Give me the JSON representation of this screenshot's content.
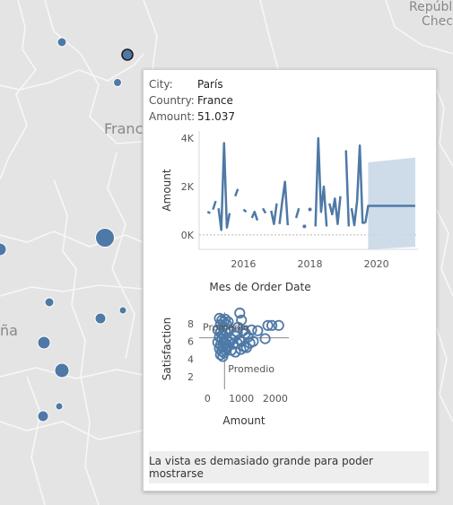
{
  "map": {
    "labels": {
      "france": "Franc",
      "spain": "ña",
      "czech_1": "Repúbl",
      "czech_2": "Checa"
    }
  },
  "tooltip": {
    "fields": [
      {
        "key": "City:",
        "value": "París"
      },
      {
        "key": "Country:",
        "value": "France"
      },
      {
        "key": "Amount:",
        "value": "51.037"
      }
    ],
    "footer": "La vista es demasiado grande para poder mostrarse"
  },
  "chart_data": [
    {
      "type": "line",
      "xlabel": "Mes de Order Date",
      "ylabel": "Amount",
      "x_ticks": [
        "2016",
        "2018",
        "2020"
      ],
      "y_ticks": [
        "4K",
        "2K",
        "0K"
      ],
      "xlim": [
        "2014-09",
        "2021-04"
      ],
      "ylim": [
        -600,
        4300
      ],
      "series_color": "#4e79a7",
      "forecast_color": "#c9d8e8",
      "segments": [
        [
          [
            "2014-12",
            950
          ],
          [
            "2015-01",
            900
          ]
        ],
        [
          [
            "2015-02",
            1050
          ],
          [
            "2015-03",
            1400
          ]
        ],
        [
          [
            "2015-04",
            1100
          ],
          [
            "2015-05",
            200
          ],
          [
            "2015-06",
            3800
          ],
          [
            "2015-07",
            300
          ],
          [
            "2015-08",
            900
          ]
        ],
        [
          [
            "2015-10",
            1600
          ],
          [
            "2015-11",
            1900
          ]
        ],
        [
          [
            "2016-01",
            1050
          ],
          [
            "2016-02",
            950
          ]
        ],
        [
          [
            "2016-04",
            700
          ],
          [
            "2016-05",
            950
          ],
          [
            "2016-06",
            600
          ]
        ],
        [
          [
            "2016-08",
            1100
          ],
          [
            "2016-09",
            900
          ]
        ],
        [
          [
            "2016-11",
            1000
          ],
          [
            "2016-12",
            450
          ],
          [
            "2017-01",
            1300
          ]
        ],
        [
          [
            "2017-02",
            450
          ],
          [
            "2017-03",
            1400
          ],
          [
            "2017-04",
            2200
          ],
          [
            "2017-05",
            400
          ]
        ],
        [
          [
            "2017-08",
            700
          ],
          [
            "2017-09",
            1100
          ]
        ],
        [
          [
            "2017-11",
            350
          ]
        ],
        [
          [
            "2018-01",
            1050
          ]
        ],
        [
          [
            "2018-03",
            350
          ],
          [
            "2018-04",
            4000
          ],
          [
            "2018-05",
            950
          ],
          [
            "2018-06",
            2000
          ],
          [
            "2018-07",
            350
          ]
        ],
        [
          [
            "2018-08",
            1300
          ],
          [
            "2018-09",
            850
          ],
          [
            "2018-10",
            1500
          ],
          [
            "2018-11",
            450
          ],
          [
            "2018-12",
            1600
          ]
        ],
        [
          [
            "2019-02",
            3500
          ],
          [
            "2019-03",
            350
          ]
        ],
        [
          [
            "2019-04",
            1100
          ],
          [
            "2019-05",
            400
          ],
          [
            "2019-06",
            1400
          ],
          [
            "2019-07",
            3700
          ],
          [
            "2019-08",
            500
          ],
          [
            "2019-09",
            500
          ]
        ],
        [
          [
            "2019-09",
            500
          ],
          [
            "2019-10",
            1200
          ],
          [
            "2021-03",
            1200
          ]
        ]
      ],
      "forecast_band": {
        "from": "2019-10",
        "to": "2021-03",
        "upper_start": 3000,
        "upper_end": 3200,
        "lower_start": -600,
        "lower_end": -500
      }
    },
    {
      "type": "scatter",
      "xlabel": "Amount",
      "ylabel": "Satisfaction",
      "x_ticks": [
        0,
        1000,
        2000
      ],
      "y_ticks": [
        2,
        4,
        6,
        8
      ],
      "xlim": [
        -250,
        2400
      ],
      "ylim": [
        1,
        9.3
      ],
      "reference_lines": {
        "x": 500,
        "y": 6.4
      },
      "reference_labels": [
        "Promedio",
        "Promedio"
      ],
      "series_color": "#4e79a7",
      "points": [
        [
          350,
          8.6
        ],
        [
          420,
          8.4
        ],
        [
          480,
          8.2
        ],
        [
          520,
          8.5
        ],
        [
          380,
          7.9
        ],
        [
          450,
          7.6
        ],
        [
          560,
          7.9
        ],
        [
          610,
          8.2
        ],
        [
          300,
          7.3
        ],
        [
          380,
          7.0
        ],
        [
          450,
          6.8
        ],
        [
          520,
          7.2
        ],
        [
          600,
          7.4
        ],
        [
          350,
          6.5
        ],
        [
          420,
          6.2
        ],
        [
          480,
          6.0
        ],
        [
          560,
          6.3
        ],
        [
          300,
          5.9
        ],
        [
          380,
          5.6
        ],
        [
          460,
          5.4
        ],
        [
          520,
          5.8
        ],
        [
          600,
          5.5
        ],
        [
          350,
          5.2
        ],
        [
          420,
          4.9
        ],
        [
          490,
          4.7
        ],
        [
          380,
          4.5
        ],
        [
          450,
          4.3
        ],
        [
          520,
          5.0
        ],
        [
          650,
          5.9
        ],
        [
          720,
          6.2
        ],
        [
          760,
          5.7
        ],
        [
          820,
          6.6
        ],
        [
          880,
          5.8
        ],
        [
          940,
          6.2
        ],
        [
          980,
          5.1
        ],
        [
          1000,
          6.0
        ],
        [
          1080,
          5.4
        ],
        [
          1120,
          6.9
        ],
        [
          900,
          7.6
        ],
        [
          1060,
          7.2
        ],
        [
          880,
          7.0
        ],
        [
          1000,
          8.4
        ],
        [
          950,
          9.2
        ],
        [
          1200,
          6.5
        ],
        [
          1250,
          5.8
        ],
        [
          1300,
          7.3
        ],
        [
          1350,
          6.0
        ],
        [
          1480,
          7.2
        ],
        [
          1700,
          6.3
        ],
        [
          1780,
          7.8
        ],
        [
          1900,
          7.8
        ],
        [
          2100,
          7.8
        ],
        [
          1150,
          5.3
        ],
        [
          820,
          4.8
        ],
        [
          700,
          5.0
        ]
      ]
    }
  ]
}
